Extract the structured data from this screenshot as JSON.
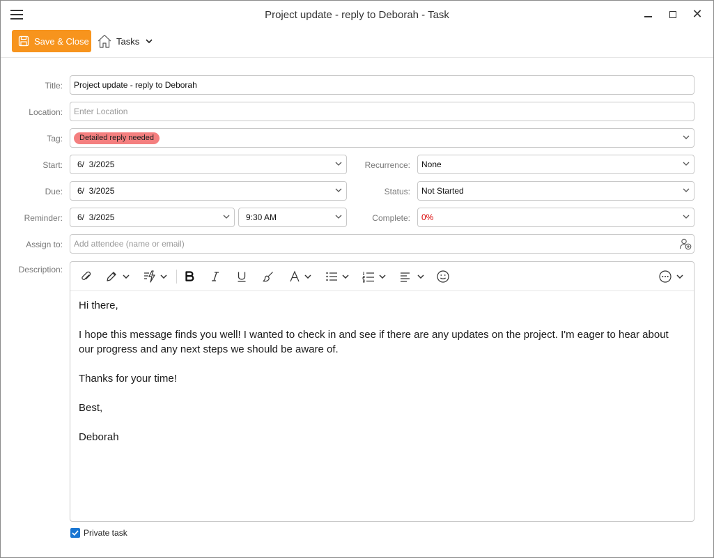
{
  "window": {
    "title": "Project update - reply to Deborah - Task",
    "close_glyph": "✕"
  },
  "toolbar": {
    "save_close_label": "Save & Close",
    "folder_label": "Tasks"
  },
  "form": {
    "title_label": "Title:",
    "title_value": "Project update - reply to Deborah",
    "location_label": "Location:",
    "location_placeholder": "Enter Location",
    "tag_label": "Tag:",
    "tag_value": "Detailed reply needed",
    "tag_color": "#f47f7f",
    "start_label": "Start:",
    "start_value": "6/  3/2025",
    "due_label": "Due:",
    "due_value": "6/  3/2025",
    "reminder_label": "Reminder:",
    "reminder_date": "6/  3/2025",
    "reminder_time": "9:30 AM",
    "recurrence_label": "Recurrence:",
    "recurrence_value": "None",
    "status_label": "Status:",
    "status_value": "Not Started",
    "complete_label": "Complete:",
    "complete_value": "0%",
    "assign_label": "Assign to:",
    "assign_placeholder": "Add attendee (name or email)",
    "description_label": "Description:"
  },
  "editor": {
    "paragraphs": [
      "Hi there,",
      "I hope this message finds you well! I wanted to check in and see if there are any updates on the project. I'm eager to hear about our progress and any next steps we should be aware of.",
      "Thanks for your time!",
      "Best,",
      "Deborah"
    ]
  },
  "footer": {
    "private_label": "Private task",
    "private_checked": true
  },
  "colors": {
    "accent": "#f7941d",
    "checkbox": "#1976d2",
    "complete_text": "#d90000"
  }
}
